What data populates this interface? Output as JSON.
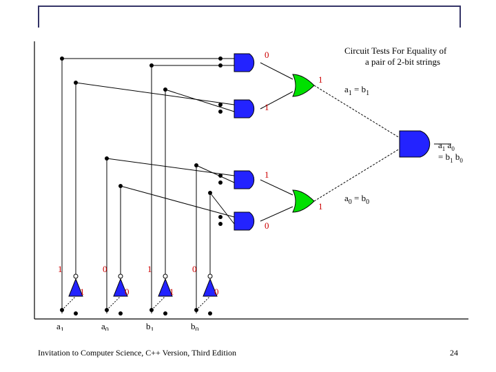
{
  "diagram": {
    "title_line1": "Circuit Tests For Equality of",
    "title_line2": "a pair of 2-bit strings",
    "inputs": {
      "a1": {
        "label": "a",
        "sub": "1",
        "value": "1"
      },
      "a0": {
        "label": "a",
        "sub": "0",
        "value": "0"
      },
      "b1": {
        "label": "b",
        "sub": "1",
        "value": "1"
      },
      "b0": {
        "label": "b",
        "sub": "0",
        "value": "0"
      }
    },
    "inverted": {
      "a1_bar": "1",
      "a0_bar": "0",
      "b1_bar": "1",
      "b0_bar": "0"
    },
    "gate_outputs": {
      "and_top": "0",
      "and_upper_mid": "1",
      "and_lower_mid": "1",
      "and_bottom": "0",
      "or_top": "1",
      "or_bottom": "1"
    },
    "eq_labels": {
      "eq1_lhs": "a",
      "eq1_lhs_sub": "1",
      "eq1_eq": "=",
      "eq1_rhs": "b",
      "eq1_rhs_sub": "1",
      "eq2_lhs": "a",
      "eq2_lhs_sub": "0",
      "eq2_eq": "=",
      "eq2_rhs": "b",
      "eq2_rhs_sub": "0",
      "final_a1": "a",
      "final_a1_sub": "1",
      "final_a0": "a",
      "final_a0_sub": "0",
      "final_eq": "=",
      "final_b1": "b",
      "final_b1_sub": "1",
      "final_b0": "b",
      "final_b0_sub": "0"
    },
    "colors": {
      "and": "#2323ff",
      "or": "#00e000",
      "not": "#2323ff",
      "wire": "#000000",
      "value": "#cc0000"
    }
  },
  "footer": "Invitation to Computer Science, C++ Version, Third Edition",
  "page": "24"
}
